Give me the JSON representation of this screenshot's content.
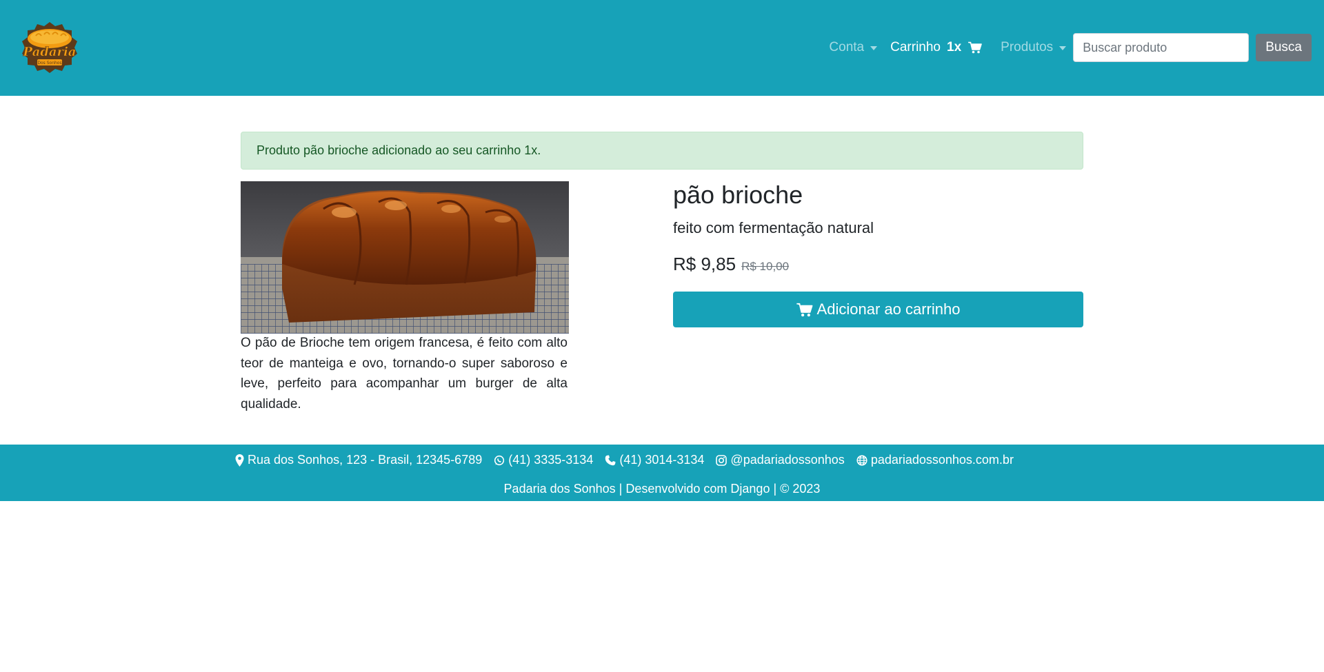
{
  "brand": {
    "logo_text": "Padaria",
    "logo_subtext": "Dos Sonhos",
    "colors": {
      "primary": "#17a2b8",
      "logo_orange": "#f39c12",
      "logo_brown": "#5d3a1a"
    }
  },
  "navbar": {
    "conta_label": "Conta",
    "cart_label": "Carrinho",
    "cart_qty": "1x",
    "produtos_label": "Produtos",
    "search_placeholder": "Buscar produto",
    "search_button": "Busca"
  },
  "alert": {
    "message": "Produto pão brioche adicionado ao seu carrinho 1x."
  },
  "product": {
    "name": "pão brioche",
    "subtitle": "feito com fermentação natural",
    "price": "R$ 9,85",
    "old_price": "R$ 10,00",
    "add_button": "Adicionar ao carrinho",
    "description": "O pão de Brioche tem origem francesa, é feito com alto teor de manteiga e ovo, tornando-o super saboroso e leve, perfeito para acompanhar um burger de alta qualidade."
  },
  "footer": {
    "address": "Rua dos Sonhos, 123 - Brasil, 12345-6789",
    "whatsapp": "(41) 3335-3134",
    "phone": "(41) 3014-3134",
    "instagram": "@padariadossonhos",
    "website": "padariadossonhos.com.br",
    "credit": "Padaria dos Sonhos | Desenvolvido com Django | © 2023"
  }
}
